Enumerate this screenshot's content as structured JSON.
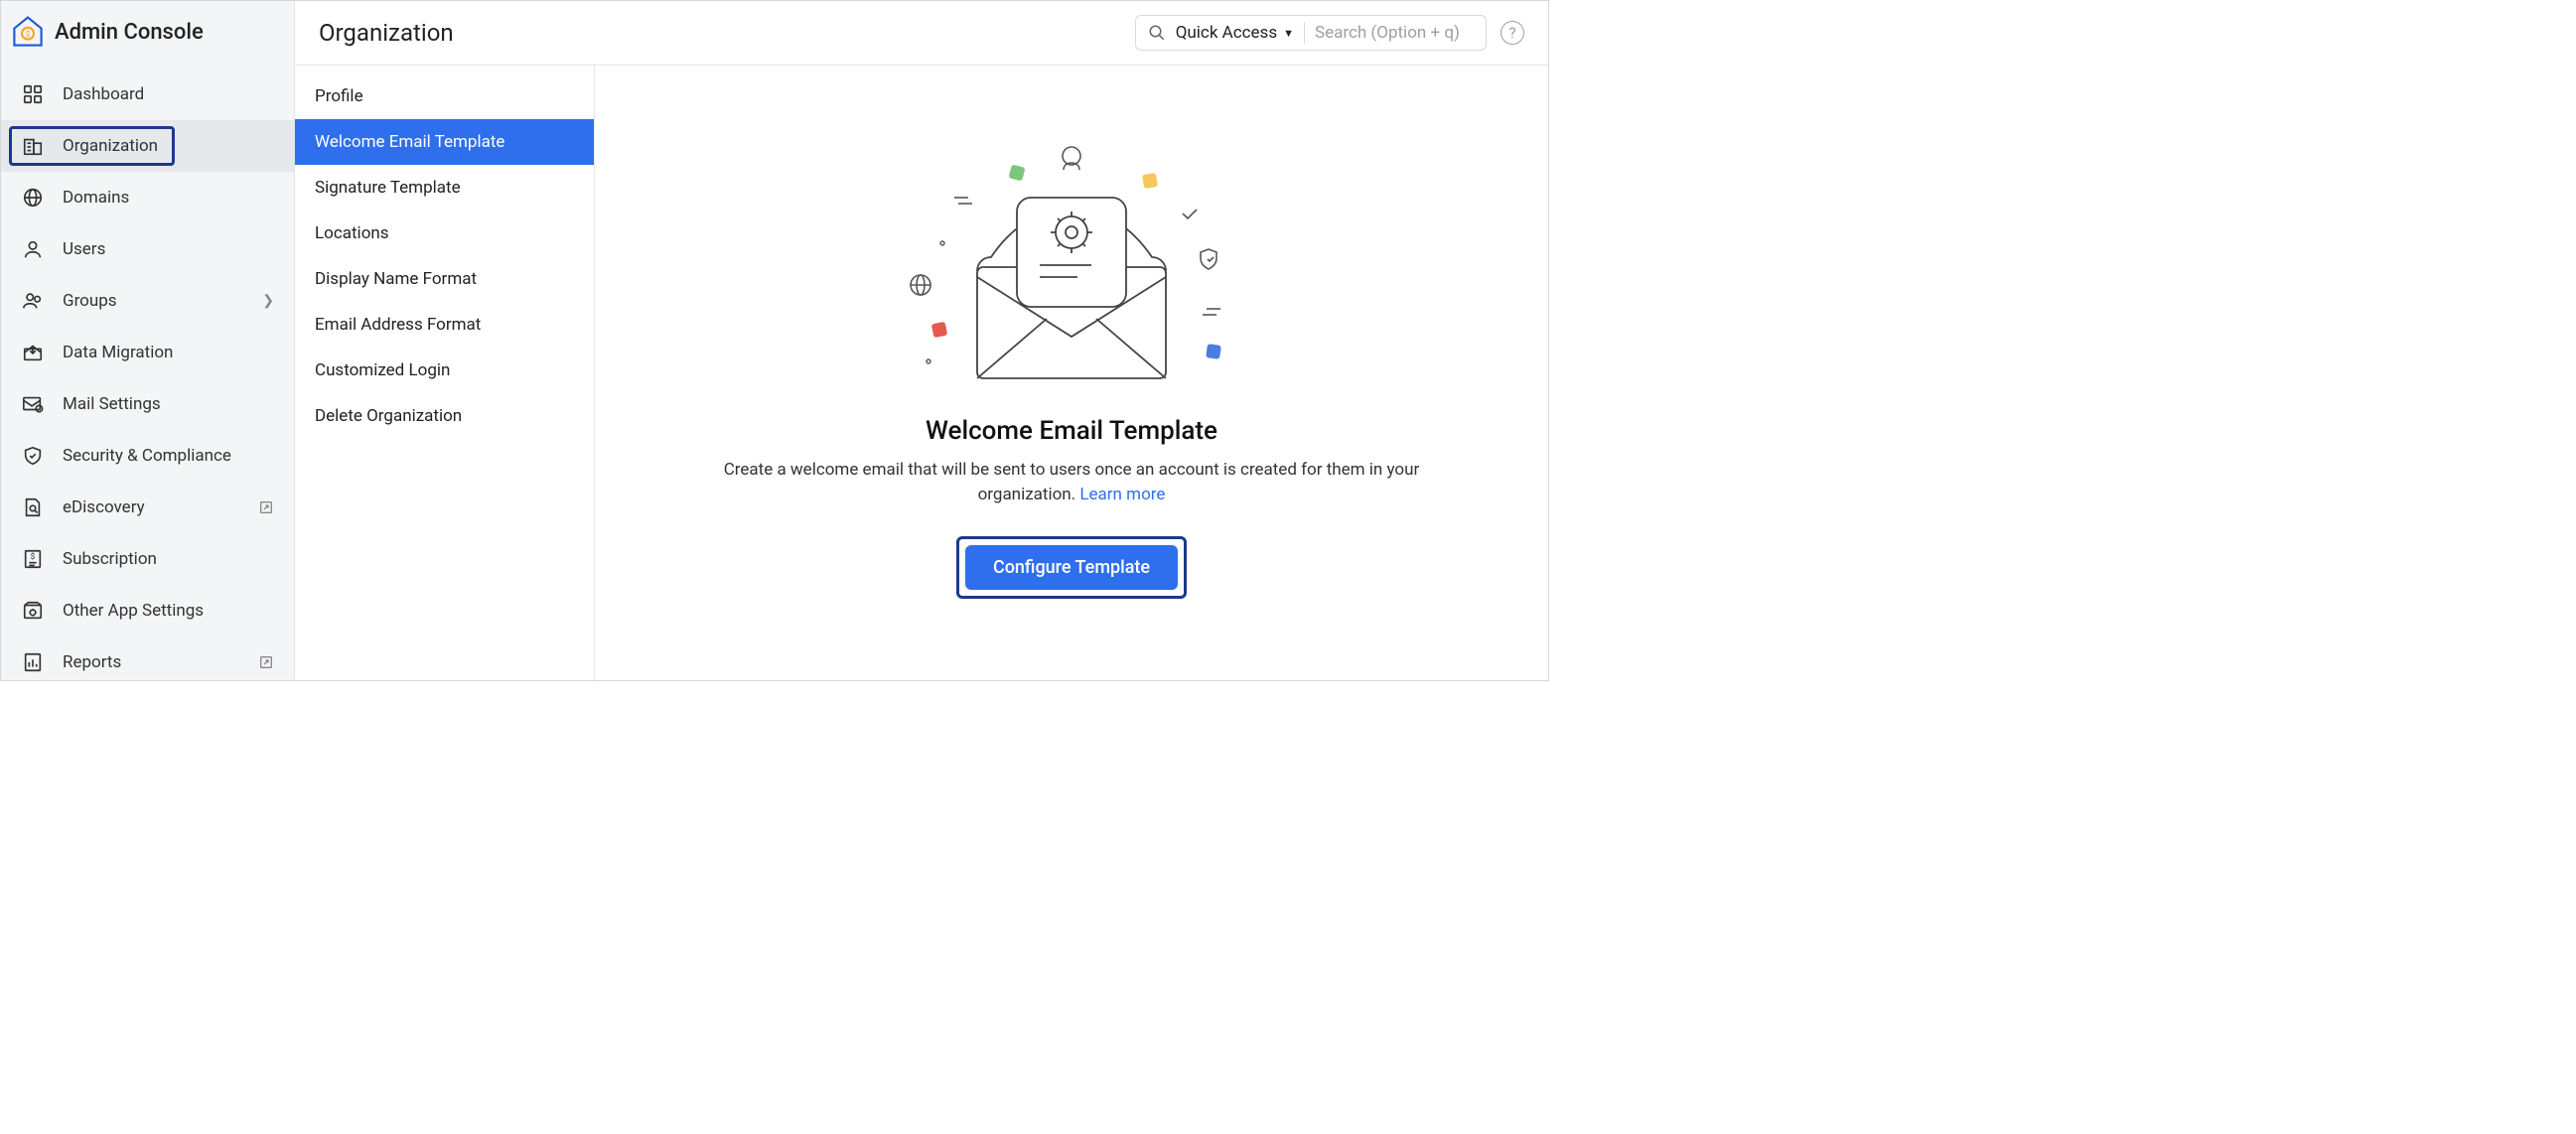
{
  "sidebar": {
    "title": "Admin Console",
    "items": [
      {
        "label": "Dashboard"
      },
      {
        "label": "Organization"
      },
      {
        "label": "Domains"
      },
      {
        "label": "Users"
      },
      {
        "label": "Groups"
      },
      {
        "label": "Data Migration"
      },
      {
        "label": "Mail Settings"
      },
      {
        "label": "Security & Compliance"
      },
      {
        "label": "eDiscovery"
      },
      {
        "label": "Subscription"
      },
      {
        "label": "Other App Settings"
      },
      {
        "label": "Reports"
      }
    ]
  },
  "header": {
    "page_title": "Organization",
    "quick_access_label": "Quick Access",
    "search_placeholder": "Search (Option + q)"
  },
  "submenu": {
    "items": [
      {
        "label": "Profile"
      },
      {
        "label": "Welcome Email Template"
      },
      {
        "label": "Signature Template"
      },
      {
        "label": "Locations"
      },
      {
        "label": "Display Name Format"
      },
      {
        "label": "Email Address Format"
      },
      {
        "label": "Customized Login"
      },
      {
        "label": "Delete Organization"
      }
    ]
  },
  "main": {
    "heading": "Welcome Email Template",
    "description": "Create a welcome email that will be sent to users once an account is created for them in your organization. ",
    "learn_more": "Learn more",
    "button": "Configure Template"
  }
}
